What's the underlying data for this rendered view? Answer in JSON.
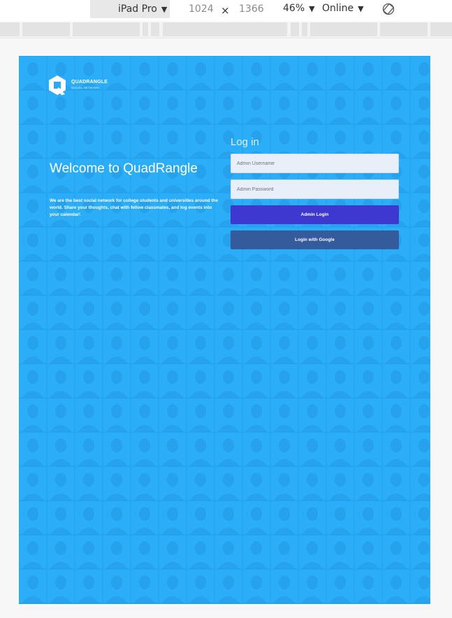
{
  "devtools": {
    "device": "iPad Pro",
    "width": "1024",
    "times": "×",
    "height": "1366",
    "zoom": "46%",
    "network": "Online",
    "dropdown_caret": "▼",
    "rotate_icon": "rotate-icon"
  },
  "page": {
    "background_color": "#29aaf7",
    "logo": {
      "name": "QUADRANGLE",
      "subtitle": "SOCIAL NETWORK"
    },
    "welcome_title": "Welcome to QuadRangle",
    "description": "We are the best social network for college students and universities around the world. Share your thoughts, chat with fellow classmates, and log events into your calendar!",
    "login": {
      "heading": "Log in",
      "username_placeholder": "Admin Username",
      "password_placeholder": "Admin Password",
      "admin_login_label": "Admin Login",
      "admin_login_color": "#3f38d0",
      "google_login_label": "Login with Google",
      "google_login_color": "#355b9d"
    }
  }
}
